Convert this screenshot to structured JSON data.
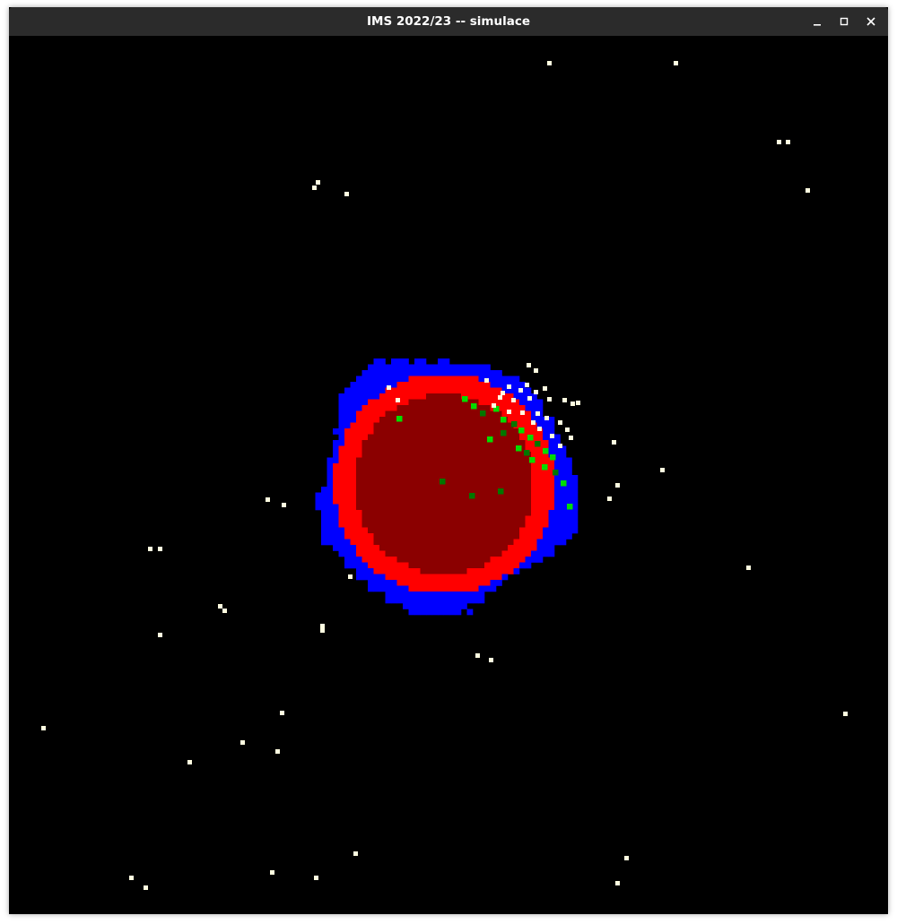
{
  "window": {
    "title": "IMS 2022/23 -- simulace",
    "controls": [
      "minimize-icon",
      "maximize-icon",
      "close-icon"
    ]
  },
  "simulation": {
    "grid_size": 150,
    "cell_colors": {
      "background": "#000000",
      "core": "#8b0000",
      "ring": "#ff0000",
      "outer_layer": "#0000ff",
      "green": "#00dd00",
      "dark_green": "#007700",
      "particle": "#fffde0"
    }
  }
}
